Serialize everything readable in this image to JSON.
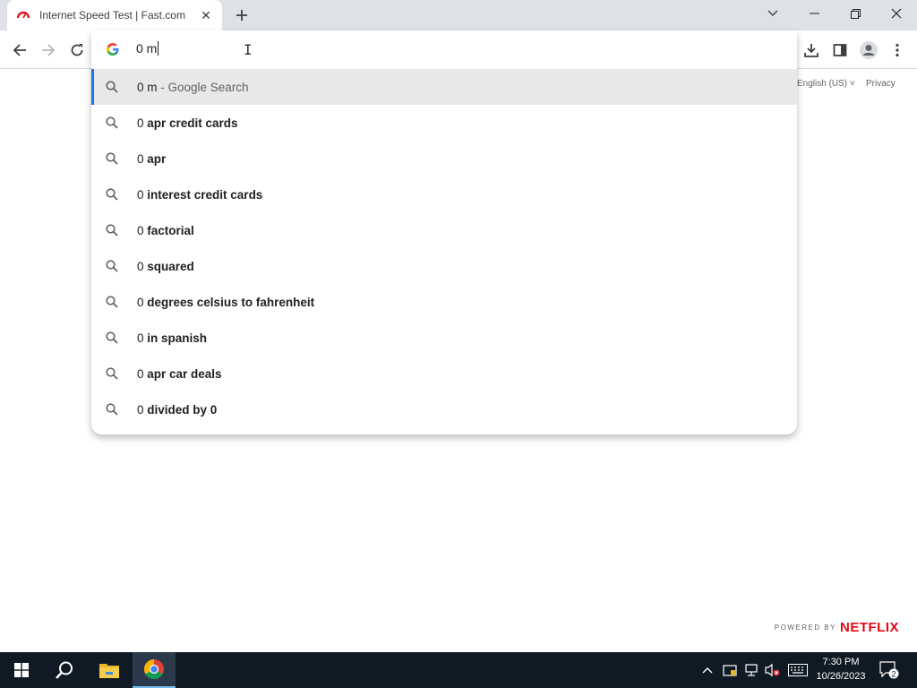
{
  "browser": {
    "tab": {
      "title": "Internet Speed Test | Fast.com"
    },
    "omnibox": {
      "value": "0 m"
    }
  },
  "suggestions": [
    {
      "prefix": "0 m",
      "bold": "",
      "desc": " - Google Search",
      "selected": true
    },
    {
      "prefix": "0 ",
      "bold": "apr credit cards",
      "desc": ""
    },
    {
      "prefix": "0 ",
      "bold": "apr",
      "desc": ""
    },
    {
      "prefix": "0 ",
      "bold": "interest credit cards",
      "desc": ""
    },
    {
      "prefix": "0 ",
      "bold": "factorial",
      "desc": ""
    },
    {
      "prefix": "0 ",
      "bold": "squared",
      "desc": ""
    },
    {
      "prefix": "0 ",
      "bold": "degrees celsius to fahrenheit",
      "desc": ""
    },
    {
      "prefix": "0 ",
      "bold": "in spanish",
      "desc": ""
    },
    {
      "prefix": "0 ",
      "bold": "apr car deals",
      "desc": ""
    },
    {
      "prefix": "0 ",
      "bold": "divided by 0",
      "desc": ""
    }
  ],
  "page": {
    "language": "English (US) ˅",
    "privacy": "Privacy",
    "powered_by": "POWERED BY",
    "brand": "NETFLIX"
  },
  "taskbar": {
    "time": "7:30 PM",
    "date": "10/26/2023",
    "notifications": "2"
  },
  "colors": {
    "accent": "#1a73e8",
    "netflix_red": "#e50914",
    "taskbar": "#101a24"
  }
}
